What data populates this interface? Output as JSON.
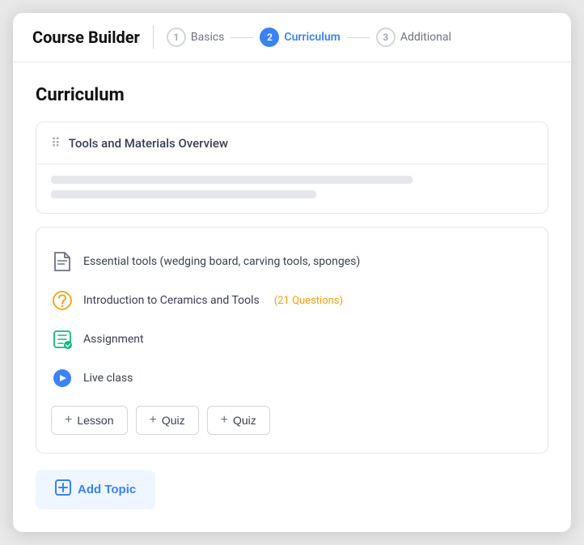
{
  "header": {
    "title": "Course Builder",
    "steps": [
      {
        "number": "1",
        "label": "Basics",
        "state": "inactive"
      },
      {
        "number": "2",
        "label": "Curriculum",
        "state": "active"
      },
      {
        "number": "3",
        "label": "Additional",
        "state": "inactive"
      }
    ]
  },
  "page": {
    "title": "Curriculum"
  },
  "topic_card": {
    "name": "Tools and Materials Overview"
  },
  "lessons": [
    {
      "id": "lesson-1",
      "icon_type": "lesson",
      "text": "Essential tools (wedging board, carving tools, sponges)",
      "quiz_count": null
    },
    {
      "id": "lesson-2",
      "icon_type": "quiz",
      "text": "Introduction to Ceramics and Tools",
      "quiz_count": "(21 Questions)"
    },
    {
      "id": "lesson-3",
      "icon_type": "assignment",
      "text": "Assignment",
      "quiz_count": null
    },
    {
      "id": "lesson-4",
      "icon_type": "live",
      "text": "Live class",
      "quiz_count": null
    }
  ],
  "add_buttons": [
    {
      "id": "lesson-btn",
      "label": "Lesson"
    },
    {
      "id": "quiz-btn-1",
      "label": "Quiz"
    },
    {
      "id": "quiz-btn-2",
      "label": "Quiz"
    }
  ],
  "add_topic": {
    "label": "Add Topic"
  }
}
